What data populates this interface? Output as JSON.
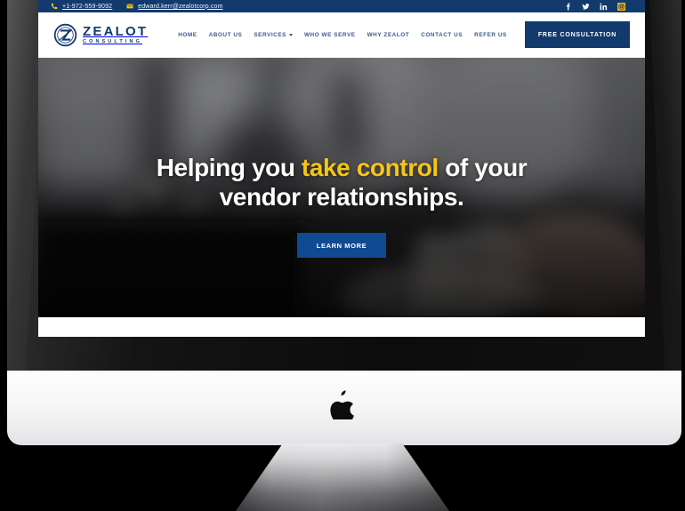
{
  "device": {
    "brand_logo": "apple-logo",
    "type": "imac-desktop"
  },
  "site": {
    "topbar": {
      "phone": {
        "icon": "phone-icon",
        "text": "+1-972-559-9092"
      },
      "email": {
        "icon": "envelope-icon",
        "text": "edward.kerr@zealotcorp.com"
      },
      "socials": [
        {
          "name": "facebook-icon",
          "glyph": "f"
        },
        {
          "name": "twitter-icon",
          "glyph": "🐦"
        },
        {
          "name": "linkedin-icon",
          "glyph": "in"
        },
        {
          "name": "instagram-icon",
          "glyph": "▣"
        }
      ]
    },
    "header": {
      "logo": {
        "word": "ZEALOT",
        "tagline": "CONSULTING",
        "trademark": "®",
        "mark": "circled-z-icon"
      },
      "nav": [
        {
          "label": "HOME",
          "has_dropdown": false
        },
        {
          "label": "ABOUT US",
          "has_dropdown": false
        },
        {
          "label": "SERVICES",
          "has_dropdown": true
        },
        {
          "label": "WHO WE SERVE",
          "has_dropdown": false
        },
        {
          "label": "WHY ZEALOT",
          "has_dropdown": false
        },
        {
          "label": "CONTACT US",
          "has_dropdown": false
        },
        {
          "label": "REFER US",
          "has_dropdown": false
        }
      ],
      "cta": "FREE CONSULTATION"
    },
    "hero": {
      "headline_part1": "Helping you ",
      "headline_accent": "take control",
      "headline_part2": " of your vendor relationships.",
      "button": "LEARN MORE",
      "background": "blurred-grayscale-business-handshake-photo"
    }
  },
  "colors": {
    "navy": "#123a6d",
    "accent_yellow": "#f5c518",
    "button_blue": "#0f4a92",
    "nav_text": "#3c5a88"
  }
}
